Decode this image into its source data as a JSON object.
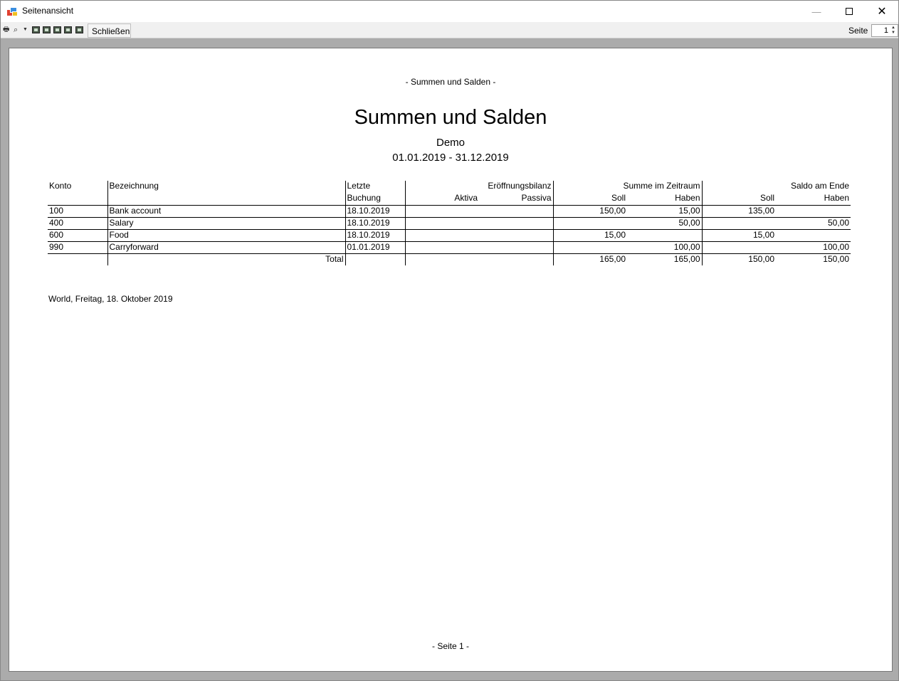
{
  "window": {
    "title": "Seitenansicht"
  },
  "toolbar": {
    "close_label": "Schließen",
    "page_label": "Seite",
    "page_value": "1"
  },
  "report": {
    "header_line": "- Summen und Salden -",
    "title": "Summen und Salden",
    "subtitle": "Demo",
    "period": "01.01.2019 - 31.12.2019",
    "columns": {
      "konto": "Konto",
      "bezeichnung": "Bezeichnung",
      "letzte": "Letzte",
      "buchung": "Buchung",
      "eroeffnungsbilanz": "Eröffnungsbilanz",
      "aktiva": "Aktiva",
      "passiva": "Passiva",
      "summe_zeitraum": "Summe im Zeitraum",
      "soll": "Soll",
      "haben": "Haben",
      "saldo_ende": "Saldo am Ende",
      "saldo_soll": "Soll",
      "saldo_haben": "Haben"
    },
    "rows": [
      {
        "konto": "100",
        "bezeichnung": "Bank account",
        "datum": "18.10.2019",
        "aktiva": "",
        "passiva": "",
        "soll": "150,00",
        "haben": "15,00",
        "saldo_soll": "135,00",
        "saldo_haben": ""
      },
      {
        "konto": "400",
        "bezeichnung": "Salary",
        "datum": "18.10.2019",
        "aktiva": "",
        "passiva": "",
        "soll": "",
        "haben": "50,00",
        "saldo_soll": "",
        "saldo_haben": "50,00"
      },
      {
        "konto": "600",
        "bezeichnung": "Food",
        "datum": "18.10.2019",
        "aktiva": "",
        "passiva": "",
        "soll": "15,00",
        "haben": "",
        "saldo_soll": "15,00",
        "saldo_haben": ""
      },
      {
        "konto": "990",
        "bezeichnung": "Carryforward",
        "datum": "01.01.2019",
        "aktiva": "",
        "passiva": "",
        "soll": "",
        "haben": "100,00",
        "saldo_soll": "",
        "saldo_haben": "100,00"
      }
    ],
    "total": {
      "label": "Total",
      "soll": "165,00",
      "haben": "165,00",
      "saldo_soll": "150,00",
      "saldo_haben": "150,00"
    },
    "footer_place_date": "World, Freitag, 18. Oktober 2019",
    "page_footer": "- Seite 1 -"
  }
}
